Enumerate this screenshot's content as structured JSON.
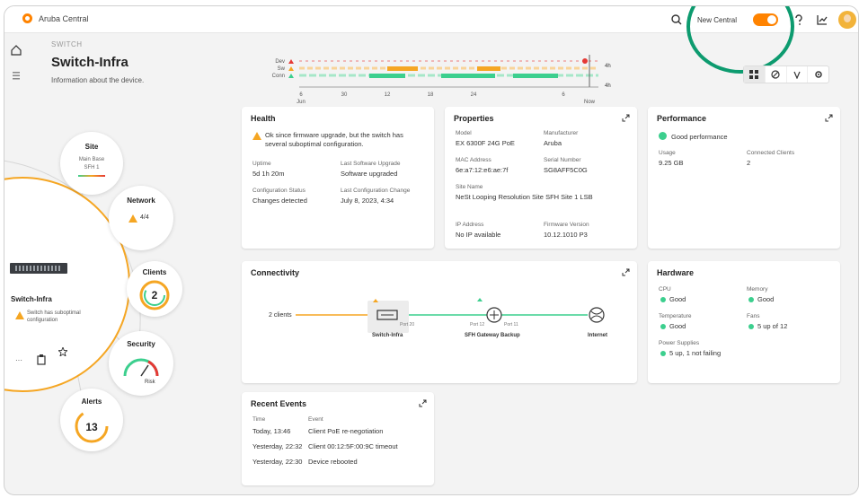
{
  "app": {
    "title": "Aruba Central"
  },
  "topbar": {
    "new_central_label": "New Central",
    "toggle_on": true,
    "accent": "#ff8300"
  },
  "breadcrumb": "SWITCH",
  "page": {
    "title": "Switch-Infra",
    "subtitle": "Information about the device."
  },
  "timeline": {
    "rows": [
      "Dev",
      "Sw",
      "Conn"
    ],
    "ticks": [
      "6",
      "30",
      "12",
      "18",
      "24",
      "6"
    ],
    "tick_sub_start": "Jun",
    "tick_sub_end": "Now",
    "end_labels": [
      "4h",
      "4h"
    ]
  },
  "view_icons": [
    "grid-icon",
    "topology-icon",
    "network-icon",
    "settings-icon"
  ],
  "health": {
    "title": "Health",
    "message": "Ok since firmware upgrade, but the switch has several suboptimal configuration.",
    "fields": [
      {
        "label": "Uptime",
        "value": "5d 1h 20m"
      },
      {
        "label": "Last Software Upgrade",
        "value": "Software upgraded"
      },
      {
        "label": "Configuration Status",
        "value": "Changes detected"
      },
      {
        "label": "Last Configuration Change",
        "value": "July 8, 2023, 4:34"
      }
    ]
  },
  "properties": {
    "title": "Properties",
    "fields": [
      {
        "label": "Model",
        "value": "EX 6300F 24G PoE"
      },
      {
        "label": "Manufacturer",
        "value": "Aruba"
      },
      {
        "label": "MAC Address",
        "value": "6e:a7:12:e6:ae:7f"
      },
      {
        "label": "Serial Number",
        "value": "SG8AFF5C0G"
      },
      {
        "label": "Site Name",
        "value": "NeSt Looping Resolution Site SFH Site 1 LSB"
      },
      {
        "label": "IP Address",
        "value": "No IP available"
      },
      {
        "label": "Firmware Version",
        "value": "10.12.1010 P3"
      }
    ]
  },
  "performance": {
    "title": "Performance",
    "status": "Good performance",
    "fields": [
      {
        "label": "Usage",
        "value": "9.25 GB"
      },
      {
        "label": "Connected Clients",
        "value": "2"
      }
    ]
  },
  "connectivity": {
    "title": "Connectivity",
    "clients_label": "2 clients",
    "switch_label": "Switch-Infra",
    "gateway_label": "SFH Gateway Backup",
    "internet_label": "Internet",
    "port_a": "Port 20",
    "port_b": "Port 12",
    "port_c": "Port 11"
  },
  "hardware": {
    "title": "Hardware",
    "items": [
      {
        "label": "CPU",
        "value": "Good"
      },
      {
        "label": "Memory",
        "value": "Good"
      },
      {
        "label": "Temperature",
        "value": "Good"
      },
      {
        "label": "Fans",
        "value": "5 up of 12"
      },
      {
        "label": "Power Supplies",
        "value": "5 up, 1 not failing"
      }
    ]
  },
  "events": {
    "title": "Recent Events",
    "col_time": "Time",
    "col_event": "Event",
    "rows": [
      {
        "time": "Today, 13:46",
        "event": "Client PoE re-negotiation"
      },
      {
        "time": "Yesterday, 22:32",
        "event": "Client 00:12:5F:00:9C timeout"
      },
      {
        "time": "Yesterday, 22:30",
        "event": "Device rebooted"
      }
    ]
  },
  "radial": {
    "site": {
      "title": "Site",
      "line1": "Main Base",
      "line2": "SFH 1"
    },
    "network": {
      "title": "Network",
      "value": "4/4"
    },
    "clients": {
      "title": "Clients",
      "value": "2"
    },
    "security": {
      "title": "Security",
      "value": "Risk"
    },
    "alerts": {
      "title": "Alerts",
      "value": "13"
    },
    "device": {
      "name": "Switch-Infra",
      "warning": "Switch has suboptimal configuration"
    }
  }
}
